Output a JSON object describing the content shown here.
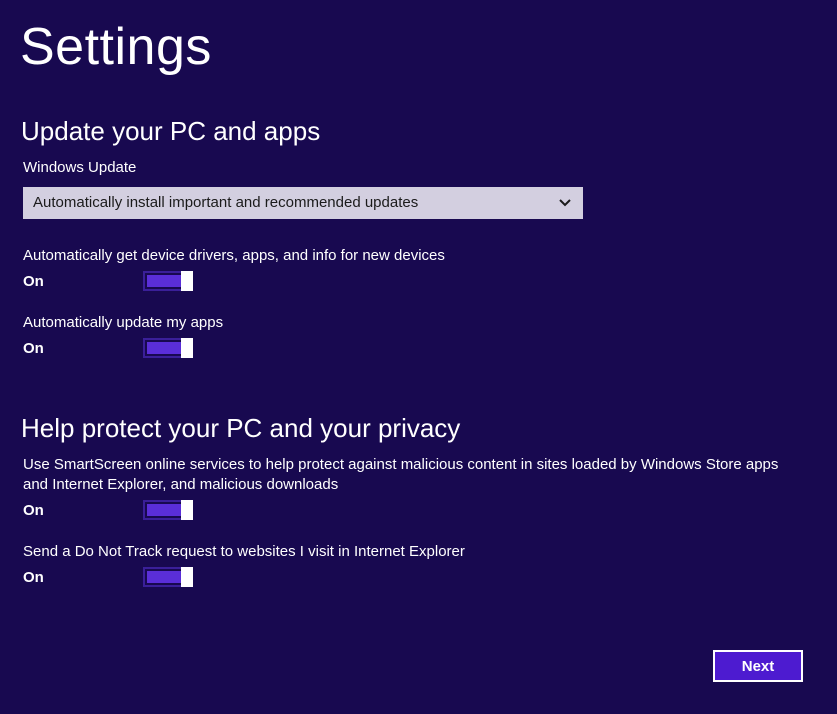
{
  "page": {
    "title": "Settings"
  },
  "update_section": {
    "title": "Update your PC and apps",
    "windows_update_label": "Windows Update",
    "windows_update_selected": "Automatically install important and recommended updates",
    "drivers_label": "Automatically get device drivers, apps, and info for new devices",
    "drivers_state": "On",
    "apps_label": "Automatically update my apps",
    "apps_state": "On"
  },
  "privacy_section": {
    "title": "Help protect your PC and your privacy",
    "smartscreen_label_line1": "Use SmartScreen online services to help protect against malicious content in sites loaded by Windows Store apps",
    "smartscreen_label_line2": "and Internet Explorer, and malicious downloads",
    "smartscreen_state": "On",
    "dnt_label": "Send a Do Not Track request to websites I visit in Internet Explorer",
    "dnt_state": "On"
  },
  "footer": {
    "next_label": "Next"
  },
  "icons": {
    "dropdown": "chevron-down-icon"
  },
  "colors": {
    "background": "#180950",
    "accent": "#5a2ed8",
    "dropdown_bg": "#d3cfe0",
    "next_button_bg": "#4d1bd0"
  }
}
